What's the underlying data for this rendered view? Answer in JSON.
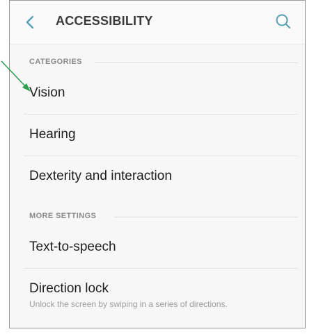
{
  "header": {
    "title": "ACCESSIBILITY"
  },
  "sections": {
    "categories_label": "CATEGORIES",
    "more_settings_label": "MORE SETTINGS"
  },
  "categories": [
    {
      "label": "Vision"
    },
    {
      "label": "Hearing"
    },
    {
      "label": "Dexterity and interaction"
    }
  ],
  "more_settings": [
    {
      "label": "Text-to-speech"
    },
    {
      "label": "Direction lock",
      "description": "Unlock the screen by swiping in a series of directions."
    }
  ],
  "colors": {
    "accent": "#4a90a8",
    "arrow": "#2e9e4f"
  }
}
